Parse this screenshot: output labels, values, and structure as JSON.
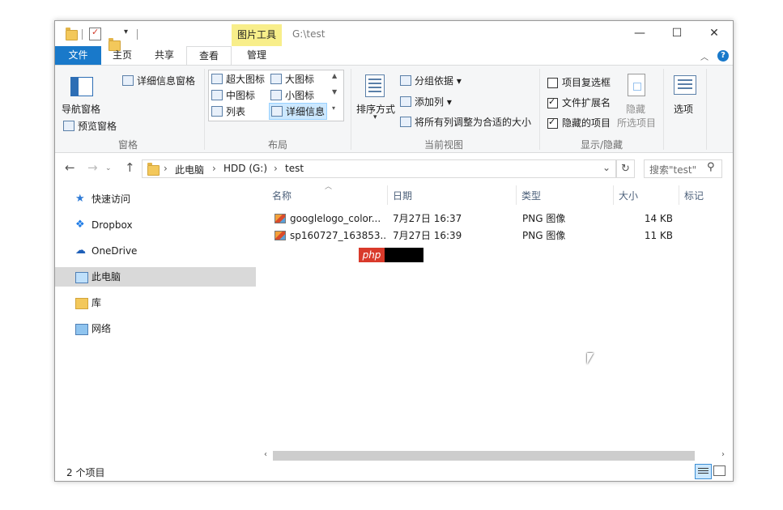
{
  "window": {
    "contextual_tab": "图片工具",
    "title_path": "G:\\test",
    "controls": {
      "minimize": "—",
      "maximize": "☐",
      "close": "✕"
    }
  },
  "tabs": [
    "文件",
    "主页",
    "共享",
    "查看",
    "管理"
  ],
  "ribbon": {
    "panes": {
      "nav_pane": "导航窗格",
      "preview_pane": "预览窗格",
      "details_pane": "详细信息窗格",
      "group": "窗格"
    },
    "layout": {
      "items": [
        "超大图标",
        "大图标",
        "中图标",
        "小图标",
        "列表",
        "详细信息"
      ],
      "group": "布局"
    },
    "current_view": {
      "sort": "排序方式",
      "group_by": "分组依据",
      "add_column": "添加列",
      "fit_columns": "将所有列调整为合适的大小",
      "group": "当前视图"
    },
    "show_hide": {
      "item_checkboxes": "项目复选框",
      "file_extensions": "文件扩展名",
      "hidden_items": "隐藏的项目",
      "hide": "隐藏",
      "selected_items": "所选项目",
      "options": "选项",
      "group": "显示/隐藏",
      "checks": [
        false,
        true,
        true
      ]
    }
  },
  "address": {
    "crumbs": [
      "此电脑",
      "HDD (G:)",
      "test"
    ],
    "search_placeholder": "搜索\"test\""
  },
  "nav": [
    {
      "label": "快速访问",
      "icon": "star-icon"
    },
    {
      "label": "Dropbox",
      "icon": "dropbox-icon"
    },
    {
      "label": "OneDrive",
      "icon": "onedrive-icon"
    },
    {
      "label": "此电脑",
      "icon": "computer-icon",
      "selected": true
    },
    {
      "label": "库",
      "icon": "library-icon"
    },
    {
      "label": "网络",
      "icon": "network-icon"
    }
  ],
  "columns": [
    "名称",
    "日期",
    "类型",
    "大小",
    "标记"
  ],
  "files": [
    {
      "name": "googlelogo_color...",
      "date": "7月27日 16:37",
      "type": "PNG 图像",
      "size": "14 KB"
    },
    {
      "name": "sp160727_163853...",
      "date": "7月27日 16:39",
      "type": "PNG 图像",
      "size": "11 KB"
    }
  ],
  "watermark": "php",
  "status": {
    "count": "2 个项目"
  },
  "colors": {
    "file_tab": "#1979ca",
    "context_tab": "#f8ee8a",
    "selected_nav": "#d9d9d9"
  }
}
